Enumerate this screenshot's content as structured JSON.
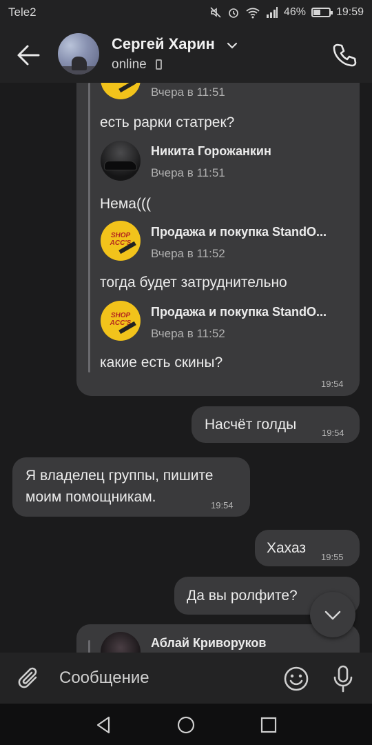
{
  "status_bar": {
    "carrier": "Tele2",
    "battery": "46%",
    "battery_level": 0.46,
    "time": "19:59",
    "icons": [
      "mute-icon",
      "alarm-icon",
      "wifi-icon",
      "signal-icon",
      "battery-icon"
    ]
  },
  "header": {
    "name": "Сергей Харин",
    "status": "online",
    "icons": [
      "back-arrow-icon",
      "chevron-down-icon",
      "mobile-icon",
      "phone-icon"
    ]
  },
  "chat": {
    "forwarded_block": {
      "top_time_fragment": "Вчера в 11:51",
      "items": [
        {
          "text": "есть рарки статрек?"
        },
        {
          "name": "Никита Горожанкин",
          "time": "Вчера в 11:51",
          "text": "Нема((("
        },
        {
          "name": "Продажа и покупка StandO...",
          "time": "Вчера в 11:52",
          "text": "тогда будет затруднительно"
        },
        {
          "name": "Продажа и покупка StandO...",
          "time": "Вчера в 11:52",
          "text": "какие есть скины?"
        }
      ],
      "avatar_logo": "SHOP ACC'S",
      "time": "19:54"
    },
    "messages": [
      {
        "side": "out",
        "text": "Насчёт голды",
        "time": "19:54"
      },
      {
        "side": "in",
        "lines": [
          "Я владелец группы, пишите",
          "моим помощникам."
        ],
        "time": "19:54"
      },
      {
        "side": "out",
        "text": "Хахаз",
        "time": "19:55"
      },
      {
        "side": "out",
        "text": "Да вы ролфите?"
      }
    ],
    "bottom_forward": {
      "name": "Аблай Криворуков"
    }
  },
  "input_bar": {
    "placeholder": "Сообщение",
    "icons": [
      "attach-icon",
      "emoji-icon",
      "microphone-icon"
    ]
  },
  "nav_bar": {
    "icons": [
      "nav-back-icon",
      "nav-home-icon",
      "nav-recents-icon"
    ]
  },
  "colors": {
    "background": "#1b1b1c",
    "bar": "#222223",
    "bubble": "#3a3a3c",
    "shop_yellow": "#f2c31b"
  }
}
